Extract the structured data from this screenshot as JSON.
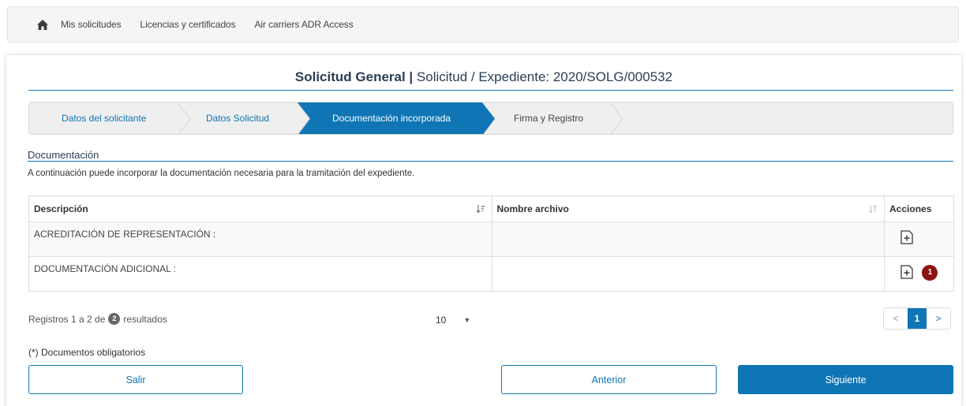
{
  "nav": {
    "home_icon": "home-icon",
    "links": [
      "Mis solicitudes",
      "Licencias y certificados",
      "Air carriers ADR Access"
    ]
  },
  "header": {
    "title_bold": "Solicitud General |",
    "title_rest": " Solicitud / Expediente: 2020/SOLG/000532"
  },
  "steps": [
    {
      "label": "Datos del solicitante",
      "state": "done"
    },
    {
      "label": "Datos Solicitud",
      "state": "done"
    },
    {
      "label": "Documentación incorporada",
      "state": "active"
    },
    {
      "label": "Firma y Registro",
      "state": "pending"
    }
  ],
  "section": {
    "title": "Documentación",
    "intro": "A continuación puede incorporar la documentación necesaria para la tramitación del expediente."
  },
  "table": {
    "columns": [
      "Descripción",
      "Nombre archivo",
      "Acciones"
    ],
    "rows": [
      {
        "descripcion": "ACREDITACIÓN DE REPRESENTACIÓN :",
        "archivo": "",
        "badge": ""
      },
      {
        "descripcion": "DOCUMENTACIÓN ADICIONAL :",
        "archivo": "",
        "badge": "1"
      }
    ]
  },
  "footer": {
    "records_prefix": "Registros 1 a 2 de",
    "records_count": "2",
    "records_suffix": "resultados",
    "page_size": "10",
    "pager": {
      "prev": "<",
      "current": "1",
      "next": ">"
    },
    "note": "(*) Documentos obligatorios",
    "buttons": {
      "exit": "Salir",
      "back": "Anterior",
      "next": "Siguiente"
    }
  },
  "colors": {
    "accent": "#0f75b5",
    "badge": "#8a1414",
    "title": "#2a3f54"
  }
}
